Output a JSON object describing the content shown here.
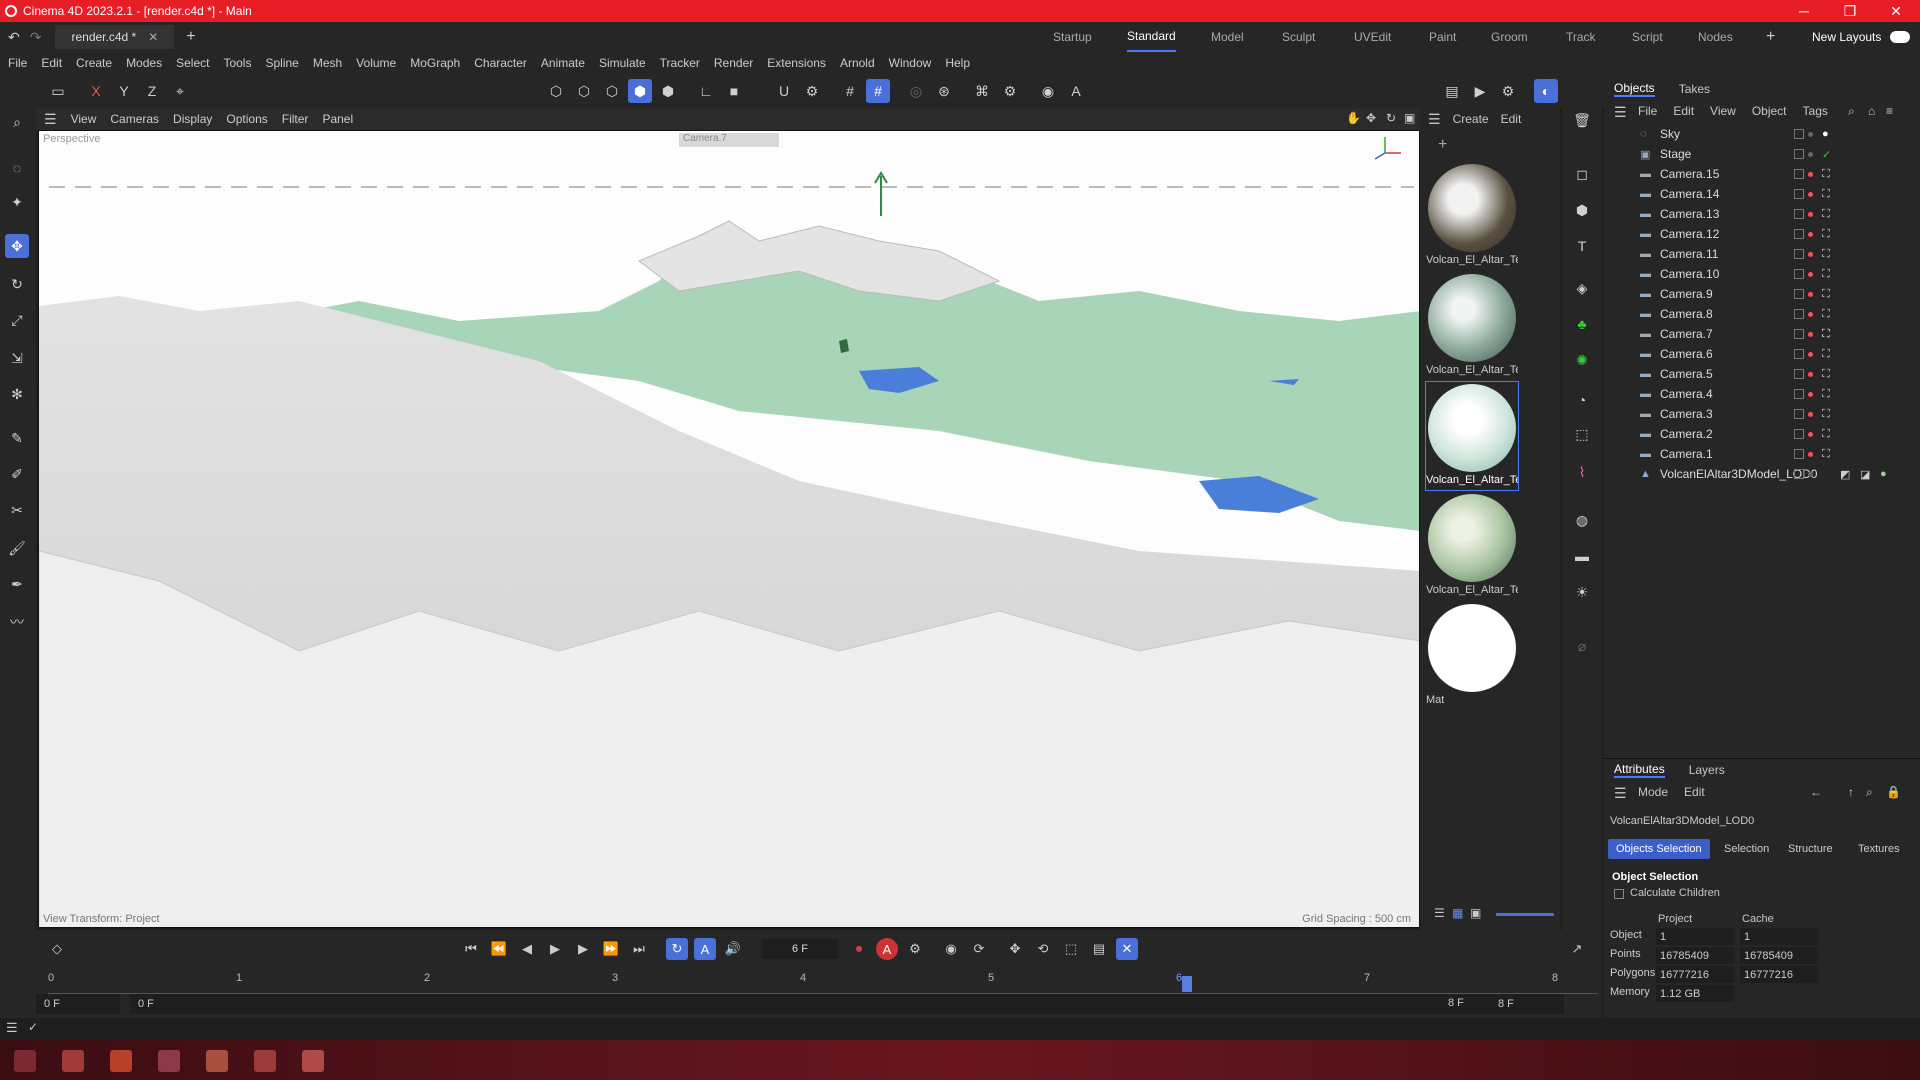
{
  "window": {
    "title": "Cinema 4D 2023.2.1 - [render.c4d *] - Main",
    "minimize": "─",
    "maximize": "❐",
    "close": "✕"
  },
  "doc_tab": {
    "label": "render.c4d *"
  },
  "layouts": [
    "Startup",
    "Standard",
    "Model",
    "Sculpt",
    "UVEdit",
    "Paint",
    "Groom",
    "Track",
    "Script",
    "Nodes"
  ],
  "layout_active": "Standard",
  "new_layouts": "New Layouts",
  "menu": [
    "File",
    "Edit",
    "Create",
    "Modes",
    "Select",
    "Tools",
    "Spline",
    "Mesh",
    "Volume",
    "MoGraph",
    "Character",
    "Animate",
    "Simulate",
    "Tracker",
    "Render",
    "Extensions",
    "Arnold",
    "Window",
    "Help"
  ],
  "axis_buttons": [
    "X",
    "Y",
    "Z"
  ],
  "viewport": {
    "menu": [
      "View",
      "Cameras",
      "Display",
      "Options",
      "Filter",
      "Panel"
    ],
    "projection": "Perspective",
    "camera": "Camera.7",
    "status_left": "View Transform: Project",
    "status_right": "Grid Spacing : 500 cm"
  },
  "materials": {
    "menu": [
      "Create",
      "Edit"
    ],
    "items": [
      {
        "label": "Volcan_El_Altar_Te",
        "color": "#5a5040"
      },
      {
        "label": "Volcan_El_Altar_Te",
        "color": "#8aa89a"
      },
      {
        "label": "Volcan_El_Altar_Te",
        "color": "#cfe6dc"
      },
      {
        "label": "Volcan_El_Altar_Te",
        "color": "#a9c4a0"
      },
      {
        "label": "Mat",
        "color": "#ffffff"
      }
    ]
  },
  "objects": {
    "tabs": [
      "Objects",
      "Takes"
    ],
    "menu": [
      "File",
      "Edit",
      "View",
      "Object",
      "Tags"
    ],
    "items": [
      {
        "name": "Sky",
        "icon": "sky-icon"
      },
      {
        "name": "Stage",
        "icon": "stage-icon"
      },
      {
        "name": "Camera.15",
        "icon": "camera-icon"
      },
      {
        "name": "Camera.14",
        "icon": "camera-icon"
      },
      {
        "name": "Camera.13",
        "icon": "camera-icon"
      },
      {
        "name": "Camera.12",
        "icon": "camera-icon"
      },
      {
        "name": "Camera.11",
        "icon": "camera-icon"
      },
      {
        "name": "Camera.10",
        "icon": "camera-icon"
      },
      {
        "name": "Camera.9",
        "icon": "camera-icon"
      },
      {
        "name": "Camera.8",
        "icon": "camera-icon"
      },
      {
        "name": "Camera.7",
        "icon": "camera-icon"
      },
      {
        "name": "Camera.6",
        "icon": "camera-icon"
      },
      {
        "name": "Camera.5",
        "icon": "camera-icon"
      },
      {
        "name": "Camera.4",
        "icon": "camera-icon"
      },
      {
        "name": "Camera.3",
        "icon": "camera-icon"
      },
      {
        "name": "Camera.2",
        "icon": "camera-icon"
      },
      {
        "name": "Camera.1",
        "icon": "camera-icon"
      },
      {
        "name": "VolcanElAltar3DModel_LOD0",
        "icon": "mesh-icon"
      }
    ]
  },
  "attributes": {
    "tabs": [
      "Attributes",
      "Layers"
    ],
    "menu": [
      "Mode",
      "Edit"
    ],
    "object_name": "VolcanElAltar3DModel_LOD0",
    "buttons": [
      "Objects Selection",
      "Selection",
      "Structure",
      "Textures"
    ],
    "section": "Object Selection",
    "calculate_children": "Calculate Children",
    "col_project": "Project",
    "col_cache": "Cache",
    "rows": [
      {
        "label": "Object",
        "project": "1",
        "cache": "1"
      },
      {
        "label": "Points",
        "project": "16785409",
        "cache": "16785409"
      },
      {
        "label": "Polygons",
        "project": "16777216",
        "cache": "16777216"
      },
      {
        "label": "Memory",
        "project": "1.12 GB",
        "cache": ""
      }
    ]
  },
  "timeline": {
    "current_frame": "6 F",
    "ticks": [
      "0",
      "1",
      "2",
      "3",
      "4",
      "5",
      "6",
      "7",
      "8"
    ],
    "start_a": "0 F",
    "start_b": "0 F",
    "end_a": "8 F",
    "end_b": "8 F"
  }
}
